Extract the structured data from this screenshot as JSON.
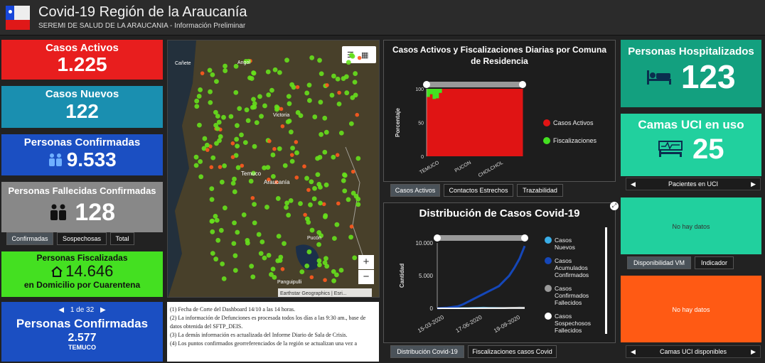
{
  "header": {
    "title": "Covid-19 Región de la Araucanía",
    "subtitle": "SEREMI DE SALUD DE LA ARAUCANIA - Información Preliminar"
  },
  "cards": {
    "activos": {
      "label": "Casos Activos",
      "value": "1.225",
      "color": "#e81e1e"
    },
    "nuevos": {
      "label": "Casos Nuevos",
      "value": "122",
      "color": "#1a8fb0"
    },
    "confirmadas": {
      "label": "Personas Confirmadas",
      "value": "9.533",
      "color": "#1b4fc2"
    },
    "fallecidas": {
      "label": "Personas Fallecidas Confirmadas",
      "value": "128",
      "color": "#888888"
    },
    "fiscalizadas": {
      "label": "Personas Fiscalizadas",
      "value": "14.646",
      "sublabel": "en Domicilio por Cuarentena",
      "color": "#44e021"
    },
    "comuna": {
      "pager": "1 de 32",
      "label": "Personas Confirmadas",
      "value": "2.577",
      "sublabel": "TEMUCO",
      "color": "#1b4fc2"
    },
    "hospitalizados": {
      "label": "Personas Hospitalizados",
      "value": "123",
      "color": "#13a07f"
    },
    "uci": {
      "label": "Camas UCI en uso",
      "value": "25",
      "color": "#21d09e"
    },
    "vm": {
      "text": "No hay datos",
      "color": "#21d09e"
    },
    "uci_disp": {
      "text": "No hay datos",
      "color": "#ff5a14"
    }
  },
  "fallecidas_tabs": [
    "Confirmadas",
    "Sospechosas",
    "Total"
  ],
  "vm_tabs": [
    "Disponibilidad VM",
    "Indicador"
  ],
  "uci_pager": "Pacientes en UCI",
  "uci_disp_pager": "Camas UCI disponibles",
  "map": {
    "labels": {
      "canete": "Cañete",
      "angol": "Angol",
      "victoria": "Victoria",
      "temuco": "Temuco",
      "araucania": "Araucanía",
      "pucon": "Pucón",
      "panguipulli": "Panguipulli"
    },
    "attribution": "Earthstar Geographics | Esri...",
    "zoom_in": "+",
    "zoom_out": "−"
  },
  "notes": [
    "(1) Fecha de Corte del Dashboard 14/10  a las 14 horas.",
    "(2)   La información de Defunciones es procesada todos los días a las 9:30 am., base de datos obtenida del SFTP_DEIS.",
    "(3) La demás información es actualizada del Informe Diario de Sala de Crisis.",
    "(4) Los puntos confirmados georreferenciados de la región se actualizan una vez a"
  ],
  "chart1": {
    "title": "Casos Activos y Fiscalizaciones Diarias por Comuna de Residencia",
    "tabs": [
      "Casos Activos",
      "Contactos Estrechos",
      "Trazabilidad"
    ]
  },
  "chart2": {
    "title": "Distribución de Casos Covid-19",
    "tabs": [
      "Distribución Covid-19",
      "Fiscalizaciones casos Covid"
    ]
  },
  "chart_data": [
    {
      "type": "bar",
      "ylabel": "Porcentaje",
      "ylim": [
        0,
        100
      ],
      "yticks": [
        "0",
        "50",
        "100"
      ],
      "categories": [
        "TEMUCO",
        "PUCON",
        "CHOLCHOL"
      ],
      "series": [
        {
          "name": "Casos Activos",
          "color": "#e01414",
          "values": [
            88,
            92,
            85,
            86,
            94,
            100,
            100,
            100,
            100,
            100,
            100,
            100,
            100,
            100,
            100,
            100,
            100,
            100,
            100,
            100,
            100,
            100,
            100,
            100,
            100,
            100,
            100,
            100,
            100,
            100,
            100,
            100
          ]
        },
        {
          "name": "Fiscalizaciones",
          "color": "#44e021",
          "values": [
            12,
            8,
            15,
            14,
            6,
            0,
            0,
            0,
            0,
            0,
            0,
            0,
            0,
            0,
            0,
            0,
            0,
            0,
            0,
            0,
            0,
            0,
            0,
            0,
            0,
            0,
            0,
            0,
            0,
            0,
            0,
            0
          ]
        }
      ],
      "legend": "right"
    },
    {
      "type": "line",
      "ylabel": "Cantidad",
      "yticks": [
        "0",
        "5.000",
        "10.000"
      ],
      "ylim": [
        0,
        10000
      ],
      "xticks": [
        "15-03-2020",
        "17-06-2020",
        "19-09-2020"
      ],
      "series": [
        {
          "name": "Casos Nuevos",
          "color": "#3aaee8",
          "values": [
            0,
            5,
            10,
            20,
            30,
            50,
            60,
            80,
            100,
            120,
            100,
            90,
            80,
            70,
            60,
            100,
            120,
            100
          ]
        },
        {
          "name": "Casos Acumulados Confirmados",
          "color": "#1547b8",
          "values": [
            0,
            50,
            100,
            200,
            300,
            600,
            1000,
            1400,
            1800,
            2200,
            2600,
            3000,
            3400,
            4200,
            5000,
            6200,
            7600,
            9533
          ]
        },
        {
          "name": "Casos Confirmados Fallecidos",
          "color": "#9a9a9a",
          "values": [
            0,
            0,
            1,
            2,
            4,
            8,
            12,
            20,
            30,
            40,
            50,
            60,
            70,
            80,
            95,
            105,
            118,
            128
          ]
        },
        {
          "name": "Casos Sospechosos Fallecidos",
          "color": "#ffffff",
          "values": [
            0,
            0,
            0,
            1,
            2,
            3,
            5,
            7,
            9,
            11,
            13,
            15,
            17,
            19,
            21,
            23,
            25,
            27
          ]
        }
      ],
      "legend": "right"
    }
  ]
}
